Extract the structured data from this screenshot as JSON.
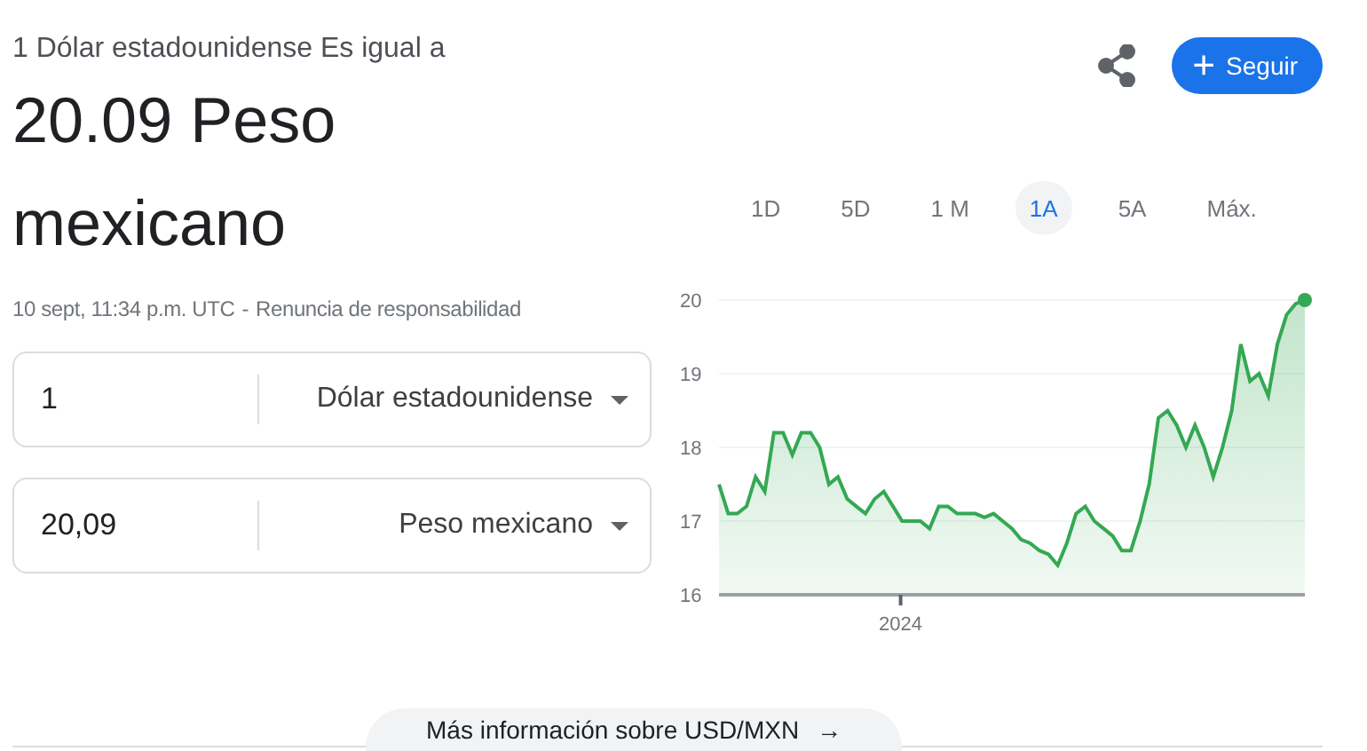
{
  "header": {
    "intro": "1 Dólar estadounidense Es igual a",
    "result": "20.09 Peso mexicano",
    "timestamp": "10 sept, 11:34 p.m. UTC",
    "separator": "-",
    "disclaimer_link": "Renuncia de responsabilidad"
  },
  "actions": {
    "follow_button": "Seguir",
    "follow_icon": "+"
  },
  "converter": [
    {
      "amount": "1",
      "currency": "Dólar estadounidense"
    },
    {
      "amount": "20,09",
      "currency": "Peso mexicano"
    }
  ],
  "ranges": [
    {
      "label": "1D",
      "selected": false
    },
    {
      "label": "5D",
      "selected": false
    },
    {
      "label": "1 M",
      "selected": false
    },
    {
      "label": "1A",
      "selected": true
    },
    {
      "label": "5A",
      "selected": false
    },
    {
      "label": "Máx.",
      "selected": false
    }
  ],
  "chart": {
    "chart_data": {
      "type": "area",
      "grid": true,
      "series": [
        {
          "color": "#34a853",
          "values": [
            17.5,
            17.1,
            17.1,
            17.2,
            17.6,
            17.4,
            18.2,
            18.2,
            17.9,
            18.2,
            18.2,
            18.0,
            17.5,
            17.6,
            17.3,
            17.2,
            17.1,
            17.3,
            17.4,
            17.2,
            17.0,
            17.0,
            17.0,
            16.9,
            17.2,
            17.2,
            17.1,
            17.1,
            17.1,
            17.05,
            17.1,
            17.0,
            16.9,
            16.75,
            16.7,
            16.6,
            16.55,
            16.4,
            16.7,
            17.1,
            17.2,
            17.0,
            16.9,
            16.8,
            16.6,
            16.6,
            17.0,
            17.5,
            18.4,
            18.5,
            18.3,
            18.0,
            18.3,
            18.0,
            17.6,
            18.0,
            18.5,
            19.4,
            18.9,
            19.0,
            18.7,
            19.4,
            19.8,
            19.95,
            20.0
          ]
        }
      ],
      "ylim": [
        16,
        20
      ],
      "yticks": [
        20,
        19,
        18,
        17,
        16
      ],
      "annotations": [
        {
          "text": "2024"
        }
      ]
    }
  },
  "more_button": "Más información sobre USD/MXN",
  "more_icon": "→"
}
